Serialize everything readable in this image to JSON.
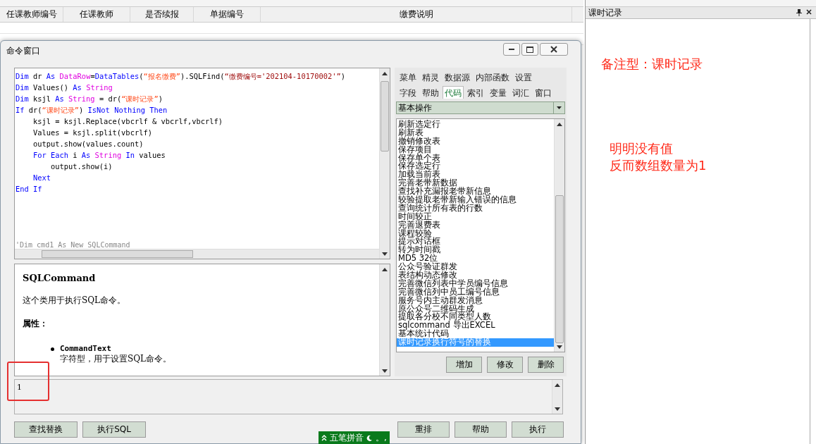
{
  "table": {
    "columns": [
      "任课教师编号",
      "任课教师",
      "是否续报",
      "单据编号",
      "缴费说明"
    ]
  },
  "command_window": {
    "title": "命令窗口",
    "code": [
      {
        "tokens": [
          {
            "kind": "keyword",
            "text": "Dim "
          },
          {
            "kind": "plain",
            "text": "dr "
          },
          {
            "kind": "keyword",
            "text": "As "
          },
          {
            "kind": "type",
            "text": "DataRow"
          },
          {
            "kind": "plain",
            "text": "="
          },
          {
            "kind": "keyword",
            "text": "DataTables"
          },
          {
            "kind": "plain",
            "text": "("
          },
          {
            "kind": "string",
            "text": "“报名缴费”"
          },
          {
            "kind": "plain",
            "text": ").SQLFind("
          },
          {
            "kind": "literal",
            "text": "“缴费编号='202104-10170002'”"
          },
          {
            "kind": "plain",
            "text": ")"
          }
        ]
      },
      {
        "tokens": [
          {
            "kind": "keyword",
            "text": "Dim "
          },
          {
            "kind": "plain",
            "text": "Values() "
          },
          {
            "kind": "keyword",
            "text": "As "
          },
          {
            "kind": "type",
            "text": "String"
          }
        ]
      },
      {
        "tokens": [
          {
            "kind": "keyword",
            "text": "Dim "
          },
          {
            "kind": "plain",
            "text": "ksjl "
          },
          {
            "kind": "keyword",
            "text": "As "
          },
          {
            "kind": "type",
            "text": "String "
          },
          {
            "kind": "plain",
            "text": "= dr("
          },
          {
            "kind": "string",
            "text": "“课时记录”"
          },
          {
            "kind": "plain",
            "text": ")"
          }
        ]
      },
      {
        "tokens": [
          {
            "kind": "keyword",
            "text": "If "
          },
          {
            "kind": "plain",
            "text": "dr("
          },
          {
            "kind": "string",
            "text": "“课时记录”"
          },
          {
            "kind": "plain",
            "text": ") "
          },
          {
            "kind": "keyword",
            "text": "IsNot Nothing Then"
          }
        ],
        "children": [
          {
            "tokens": [
              {
                "kind": "plain",
                "text": "ksjl = ksjl.Replace(vbcrlf & vbcrlf,vbcrlf)"
              }
            ]
          },
          {
            "tokens": [
              {
                "kind": "plain",
                "text": "Values = ksjl.split(vbcrlf)"
              }
            ]
          },
          {
            "tokens": [
              {
                "kind": "plain",
                "text": "output.show(values.count)"
              }
            ]
          },
          {
            "tokens": [
              {
                "kind": "keyword",
                "text": "For Each "
              },
              {
                "kind": "plain",
                "text": "i "
              },
              {
                "kind": "keyword",
                "text": "As "
              },
              {
                "kind": "type",
                "text": "String "
              },
              {
                "kind": "keyword",
                "text": "In "
              },
              {
                "kind": "plain",
                "text": "values"
              }
            ],
            "children": [
              {
                "tokens": [
                  {
                    "kind": "plain",
                    "text": "output.show(i)"
                  }
                ]
              }
            ]
          },
          {
            "tokens": [
              {
                "kind": "keyword",
                "text": "Next"
              }
            ]
          }
        ]
      },
      {
        "tokens": [
          {
            "kind": "keyword",
            "text": "End If"
          }
        ]
      }
    ],
    "code_tail": "'Dim cmd1 As New SQLCommand",
    "tool_tabs": [
      [
        {
          "label": "菜单",
          "selected": false
        },
        {
          "label": "精灵",
          "selected": false
        },
        {
          "label": "数据源",
          "selected": false
        },
        {
          "label": "内部函数",
          "selected": false
        },
        {
          "label": "设置",
          "selected": false
        }
      ],
      [
        {
          "label": "字段",
          "selected": false
        },
        {
          "label": "帮助",
          "selected": false
        },
        {
          "label": "代码",
          "selected": true
        },
        {
          "label": "索引",
          "selected": false
        },
        {
          "label": "变量",
          "selected": false
        },
        {
          "label": "词汇",
          "selected": false
        },
        {
          "label": "窗口",
          "selected": false
        }
      ]
    ],
    "category": "基本操作",
    "snippets": [
      {
        "label": "刷新选定行",
        "selected": false
      },
      {
        "label": "刷新表",
        "selected": false
      },
      {
        "label": "撤销修改表",
        "selected": false
      },
      {
        "label": "保存项目",
        "selected": false
      },
      {
        "label": "保存单个表",
        "selected": false
      },
      {
        "label": "保存选定行",
        "selected": false
      },
      {
        "label": "加载当前表",
        "selected": false
      },
      {
        "label": "完善老带新数据",
        "selected": false
      },
      {
        "label": "查找补充漏报老带新信息",
        "selected": false
      },
      {
        "label": "较验提取老带新输入错误的信息",
        "selected": false
      },
      {
        "label": "查询统计所有表的行数",
        "selected": false
      },
      {
        "label": "时间较正",
        "selected": false
      },
      {
        "label": "完善退费表",
        "selected": false
      },
      {
        "label": "课程较验",
        "selected": false
      },
      {
        "label": "提示对话框",
        "selected": false
      },
      {
        "label": "转为时间戳",
        "selected": false
      },
      {
        "label": "MD5 32位",
        "selected": false
      },
      {
        "label": "公众号验证群发",
        "selected": false
      },
      {
        "label": "表结构动态修改",
        "selected": false
      },
      {
        "label": "完善微信列表中学员编号信息",
        "selected": false
      },
      {
        "label": "完善微信列中员工编号信息",
        "selected": false
      },
      {
        "label": "服务号内主动群发消息",
        "selected": false
      },
      {
        "label": "原公众号二维码生成",
        "selected": false
      },
      {
        "label": "提取各分校不同类型人数",
        "selected": false
      },
      {
        "label": "sqlcommand 导出EXCEL",
        "selected": false
      },
      {
        "label": "基本统计代码",
        "selected": false
      },
      {
        "label": "课时记录换行符号的替换",
        "selected": true
      }
    ],
    "snippet_buttons": [
      "增加",
      "修改",
      "删除"
    ],
    "help": {
      "title": "SQLCommand",
      "intro": "这个类用于执行SQL命令。",
      "section": "属性：",
      "items": [
        {
          "name": "CommandText",
          "desc": "字符型，用于设置SQL命令。"
        }
      ]
    },
    "output": "1",
    "left_buttons": [
      "查找替换",
      "执行SQL"
    ],
    "right_buttons": [
      "重排",
      "帮助",
      "执行"
    ]
  },
  "ime": {
    "label": "五笔拼音",
    "extra": "。,"
  },
  "side_panel": {
    "title": "课时记录",
    "notes": [
      {
        "lines": [
          "备注型：课时记录"
        ]
      },
      {
        "lines": [
          "明明没有值",
          "反而数组数量为1"
        ]
      }
    ]
  }
}
